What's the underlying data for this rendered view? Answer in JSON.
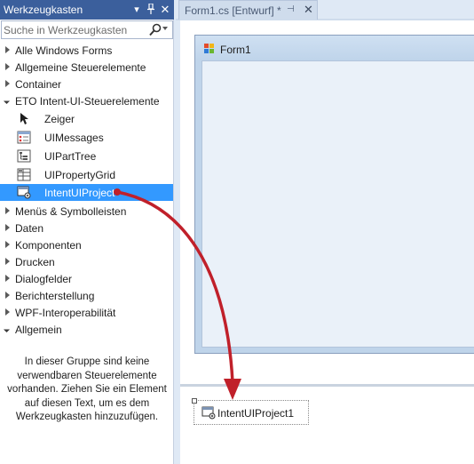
{
  "toolbox": {
    "title": "Werkzeugkasten",
    "search_placeholder": "Suche in Werkzeugkasten",
    "groups_top": [
      "Alle Windows Forms",
      "Allgemeine Steuerelemente",
      "Container"
    ],
    "eto_group": {
      "label": "ETO Intent-UI-Steuerelemente",
      "items": [
        {
          "label": "Zeiger",
          "icon": "pointer-icon"
        },
        {
          "label": "UIMessages",
          "icon": "ui-messages-icon"
        },
        {
          "label": "UIPartTree",
          "icon": "ui-part-tree-icon"
        },
        {
          "label": "UIPropertyGrid",
          "icon": "ui-property-grid-icon"
        },
        {
          "label": "IntentUIProject",
          "icon": "intent-ui-project-icon",
          "selected": true
        }
      ]
    },
    "groups_bottom": [
      "Menüs & Symbolleisten",
      "Daten",
      "Komponenten",
      "Drucken",
      "Dialogfelder",
      "Berichterstellung",
      "WPF-Interoperabilität"
    ],
    "general_group": {
      "label": "Allgemein",
      "empty_message": "In dieser Gruppe sind keine verwendbaren Steuerelemente vorhanden. Ziehen Sie ein Element auf diesen Text, um es dem Werkzeugkasten hinzuzufügen."
    }
  },
  "document_tab": {
    "label": "Form1.cs [Entwurf]",
    "modified_marker": "*"
  },
  "designer": {
    "form_title": "Form1",
    "tray_component": "IntentUIProject1"
  },
  "colors": {
    "title_bar": "#3b5f9c",
    "selection": "#3399ff",
    "drag_arrow": "#c0202a"
  }
}
